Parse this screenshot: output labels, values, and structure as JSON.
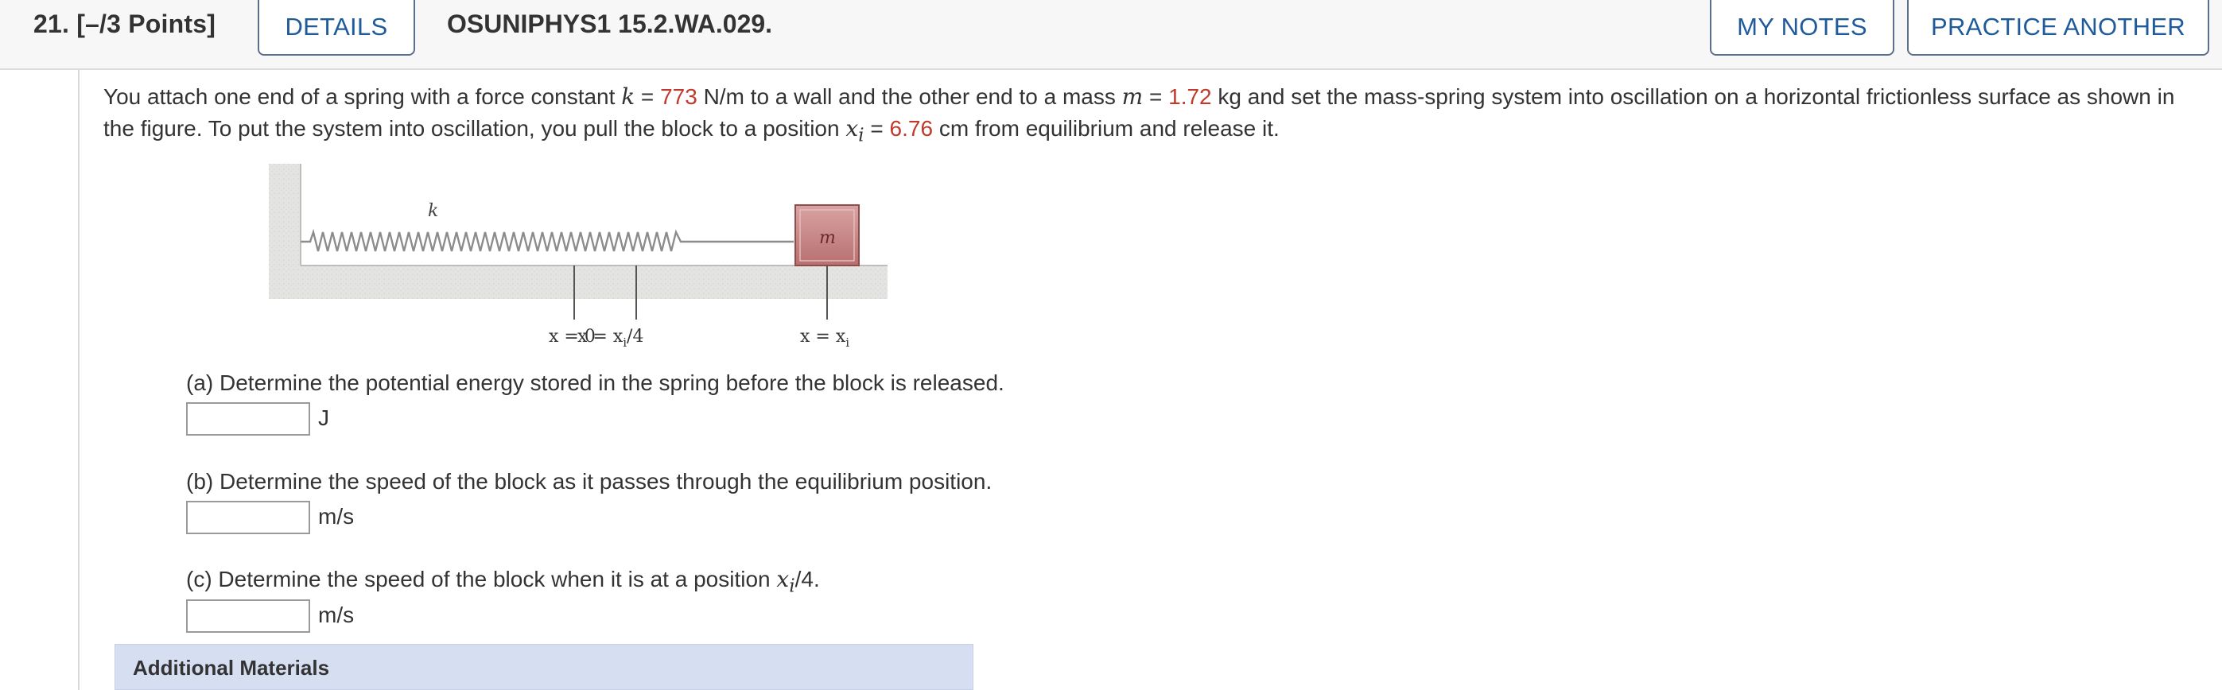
{
  "header": {
    "question_number": "21.",
    "points": "[–/3 Points]",
    "details_label": "DETAILS",
    "question_code": "OSUNIPHYS1 15.2.WA.029.",
    "my_notes_label": "MY NOTES",
    "practice_another_label": "PRACTICE ANOTHER"
  },
  "problem": {
    "t1": "You attach one end of a spring with a force constant ",
    "k_var": "k",
    "eq1": " = ",
    "k_value": "773",
    "t2": " N/m to a wall and the other end to a mass ",
    "m_var": "m",
    "eq2": " = ",
    "m_value": "1.72",
    "t3": " kg and set the mass-spring system into oscillation on a horizontal frictionless surface as shown in the figure. To put the system into oscillation, you pull the block to a position ",
    "xi_var": "x",
    "xi_sub": "i",
    "eq3": " = ",
    "xi_value": "6.76",
    "t4": " cm from equilibrium and release it."
  },
  "figure": {
    "spring_label": "k",
    "mass_label": "m",
    "label_x0": "x = 0",
    "label_xq_main": "x = x",
    "label_xq_sub": "i",
    "label_xq_tail": "/4",
    "label_xi_main": "x = x",
    "label_xi_sub": "i"
  },
  "parts": [
    {
      "text": "(a) Determine the potential energy stored in the spring before the block is released.",
      "unit": "J",
      "value": ""
    },
    {
      "text": "(b) Determine the speed of the block as it passes through the equilibrium position.",
      "unit": "m/s",
      "value": ""
    },
    {
      "text_pre": "(c) Determine the speed of the block when it is at a position ",
      "var": "x",
      "sub": "i",
      "text_post": "/4.",
      "unit": "m/s",
      "value": ""
    }
  ],
  "additional_materials": {
    "label": "Additional Materials"
  },
  "colors": {
    "accent": "#1f5b9a",
    "given_value": "#c0392b",
    "materials_bg": "#d6def2"
  }
}
